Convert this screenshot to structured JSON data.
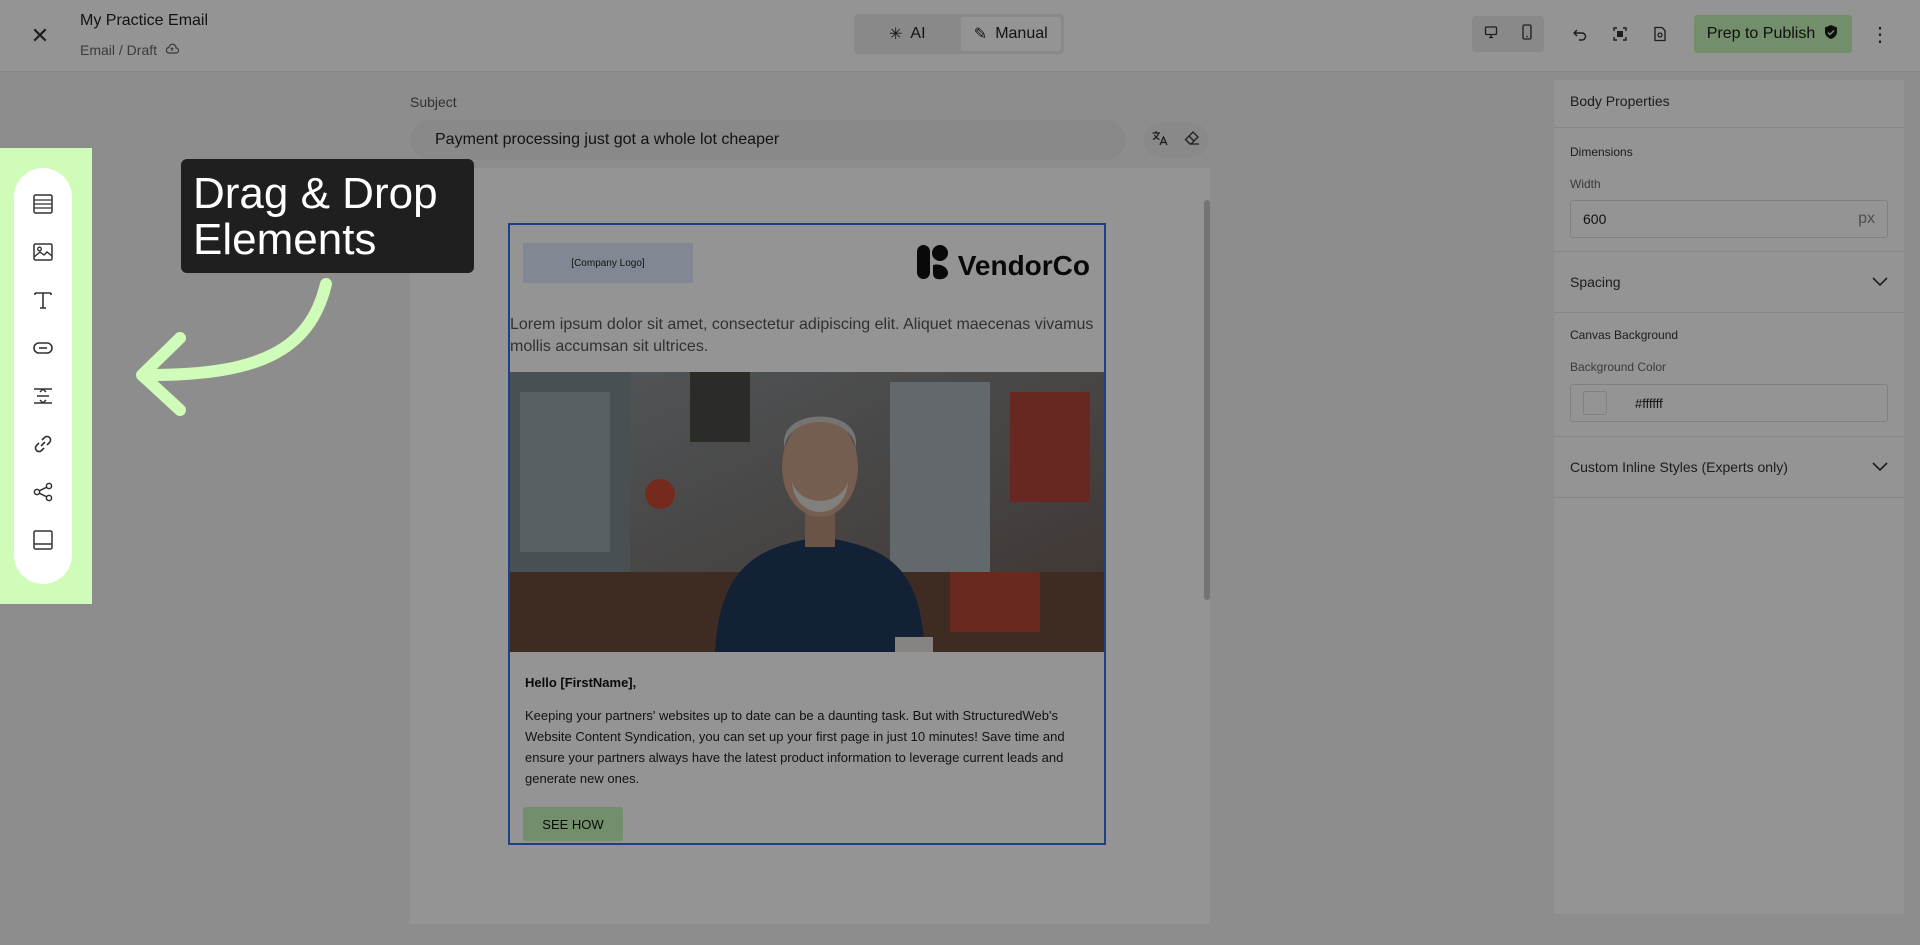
{
  "header": {
    "title": "My Practice Email",
    "subtitle": "Email / Draft",
    "mode": {
      "ai_label": "AI",
      "manual_label": "Manual",
      "active": "Manual"
    },
    "publish_label": "Prep to Publish"
  },
  "subject": {
    "label": "Subject",
    "value": "Payment processing just got a whole lot cheaper"
  },
  "email": {
    "logo_placeholder": "[Company Logo]",
    "brand": "VendorCo",
    "intro": "Lorem ipsum dolor sit amet, consectetur adipiscing elit. Aliquet maecenas vivamus mollis accumsan sit ultrices.",
    "greeting": "Hello [FirstName],",
    "body": "Keeping your partners' websites up to date can be a daunting task. But with StructuredWeb's Website Content Syndication, you can set up your first page in just 10 minutes! Save time and ensure your partners always have the latest product information to leverage current leads and generate new ones.",
    "cta": "SEE HOW"
  },
  "panel": {
    "title": "Body Properties",
    "dimensions_title": "Dimensions",
    "width_label": "Width",
    "width_value": "600",
    "width_unit": "px",
    "spacing_label": "Spacing",
    "canvas_bg_title": "Canvas Background",
    "bg_color_label": "Background Color",
    "bg_color_value": "#ffffff",
    "custom_styles_label": "Custom Inline Styles (Experts only)"
  },
  "toolbar_items": [
    "rows-icon",
    "image-icon",
    "text-icon",
    "button-icon",
    "spacer-icon",
    "link-icon",
    "share-icon",
    "footer-icon"
  ],
  "callout": {
    "line1": "Drag & Drop",
    "line2": "Elements"
  },
  "colors": {
    "accent_green": "#c7f5b7",
    "highlight_green": "#cffcb8",
    "selection_blue": "#2f6fe4"
  }
}
